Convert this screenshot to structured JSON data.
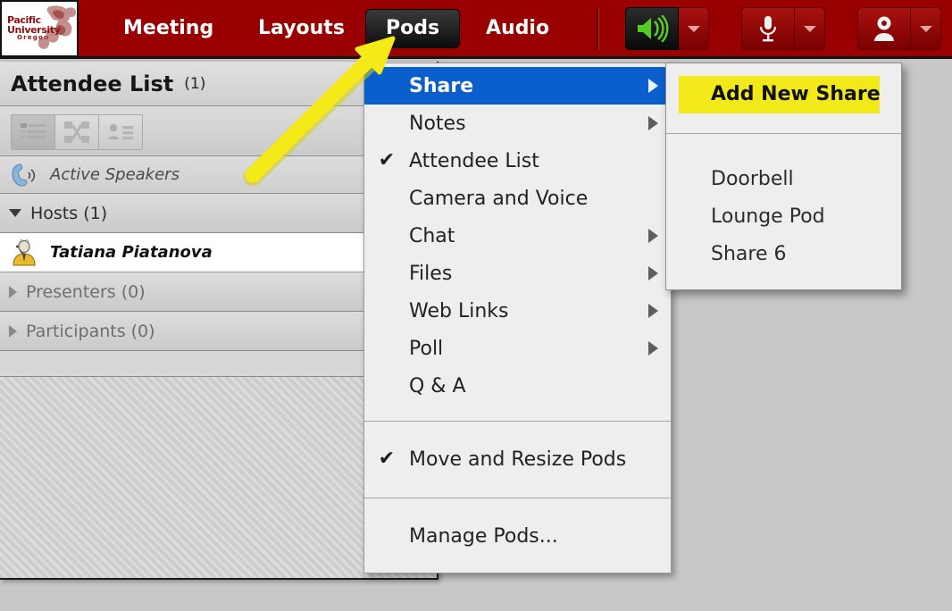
{
  "app": {
    "logo": {
      "line1": "Pacific",
      "line2": "University",
      "line3": "Oregon",
      "brand_color": "#8d1111"
    },
    "menubar_color": "#990000",
    "menus": [
      {
        "label": "Meeting",
        "active": false
      },
      {
        "label": "Layouts",
        "active": false
      },
      {
        "label": "Pods",
        "active": true
      },
      {
        "label": "Audio",
        "active": false
      }
    ],
    "tools": [
      {
        "icon": "speaker-icon",
        "state": "on",
        "has_dropdown": true
      },
      {
        "icon": "microphone-icon",
        "state": "off",
        "has_dropdown": true
      },
      {
        "icon": "webcam-icon",
        "state": "off",
        "has_dropdown": true
      }
    ]
  },
  "attendee_pod": {
    "title": "Attendee List",
    "count": "(1)",
    "view_buttons": [
      {
        "icon": "list-view-icon",
        "selected": true
      },
      {
        "icon": "breakout-grid-icon",
        "selected": false
      },
      {
        "icon": "attendee-detail-icon",
        "selected": false
      }
    ],
    "active_speakers_label": "Active Speakers",
    "groups": [
      {
        "name": "Hosts (1)",
        "expanded": true,
        "members": [
          {
            "name": "Tatiana Piatanova"
          }
        ]
      },
      {
        "name": "Presenters (0)",
        "expanded": false,
        "members": []
      },
      {
        "name": "Participants (0)",
        "expanded": false,
        "members": []
      }
    ]
  },
  "pods_menu": {
    "highlight_color": "#0a5fcc",
    "items": [
      {
        "label": "Share",
        "checked": false,
        "submenu": true,
        "highlighted": true
      },
      {
        "label": "Notes",
        "checked": false,
        "submenu": true,
        "highlighted": false
      },
      {
        "label": "Attendee List",
        "checked": true,
        "submenu": false,
        "highlighted": false
      },
      {
        "label": "Camera and Voice",
        "checked": false,
        "submenu": false,
        "highlighted": false
      },
      {
        "label": "Chat",
        "checked": false,
        "submenu": true,
        "highlighted": false
      },
      {
        "label": "Files",
        "checked": false,
        "submenu": true,
        "highlighted": false
      },
      {
        "label": "Web Links",
        "checked": false,
        "submenu": true,
        "highlighted": false
      },
      {
        "label": "Poll",
        "checked": false,
        "submenu": true,
        "highlighted": false
      },
      {
        "label": "Q & A",
        "checked": false,
        "submenu": false,
        "highlighted": false
      },
      {
        "label": "Move and Resize Pods",
        "checked": true,
        "submenu": false,
        "highlighted": false
      },
      {
        "label": "Manage Pods...",
        "checked": false,
        "submenu": false,
        "highlighted": false
      }
    ],
    "checkmark_glyph": "✔"
  },
  "share_submenu": {
    "annotation_color": "#f2e91b",
    "items": [
      {
        "label": "Add New Share",
        "annotated": true
      },
      {
        "label": "Doorbell",
        "annotated": false
      },
      {
        "label": "Lounge Pod",
        "annotated": false
      },
      {
        "label": "Share 6",
        "annotated": false
      }
    ]
  },
  "annotation": {
    "arrow_color": "#f3ea18",
    "points_to": "Pods"
  }
}
